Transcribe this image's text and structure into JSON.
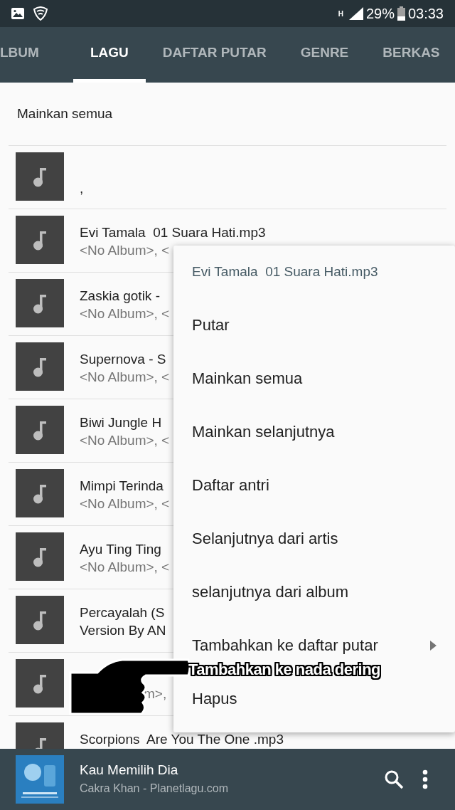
{
  "status_bar": {
    "network": "H",
    "battery": "29%",
    "time": "03:33"
  },
  "tabs": [
    {
      "label": "LBUM",
      "selected": false
    },
    {
      "label": "LAGU",
      "selected": true
    },
    {
      "label": "DAFTAR PUTAR",
      "selected": false
    },
    {
      "label": "GENRE",
      "selected": false
    },
    {
      "label": "BERKAS",
      "selected": false
    }
  ],
  "play_all": "Mainkan semua",
  "songs": [
    {
      "lines": [
        ","
      ]
    },
    {
      "lines": [
        "Evi Tamala  01 Suara Hati.mp3",
        "<No Album>, <"
      ]
    },
    {
      "lines": [
        "Zaskia gotik -",
        "<No Album>, <"
      ]
    },
    {
      "lines": [
        "Supernova - S",
        "<No Album>, <"
      ]
    },
    {
      "lines": [
        "Biwi Jungle H",
        "<No Album>, <"
      ]
    },
    {
      "lines": [
        "Mimpi Terinda",
        "<No Album>, <"
      ]
    },
    {
      "lines": [
        "Ayu Ting Ting",
        "<No Album>, <"
      ]
    },
    {
      "lines": [
        "Percayalah (S",
        "Version By AN"
      ]
    },
    {
      "fragment": "m>,"
    },
    {
      "lines": [
        "Scorpions  Are You The One .mp3"
      ]
    }
  ],
  "context_menu": {
    "title": "Evi Tamala  01 Suara Hati.mp3",
    "items": [
      {
        "label": "Putar",
        "kind": "action"
      },
      {
        "label": "Mainkan semua",
        "kind": "action"
      },
      {
        "label": "Mainkan selanjutnya",
        "kind": "action"
      },
      {
        "label": "Daftar antri",
        "kind": "action"
      },
      {
        "label": "Selanjutnya dari artis",
        "kind": "action"
      },
      {
        "label": "selanjutnya dari album",
        "kind": "action"
      },
      {
        "label": "Tambahkan ke daftar putar",
        "kind": "submenu"
      },
      {
        "label": "Hapus",
        "kind": "action"
      }
    ]
  },
  "annotation": {
    "text": "Tambahkan ke nada dering"
  },
  "now_playing": {
    "title": "Kau Memilih Dia",
    "artist": "Cakra Khan - Planetlagu.com"
  }
}
